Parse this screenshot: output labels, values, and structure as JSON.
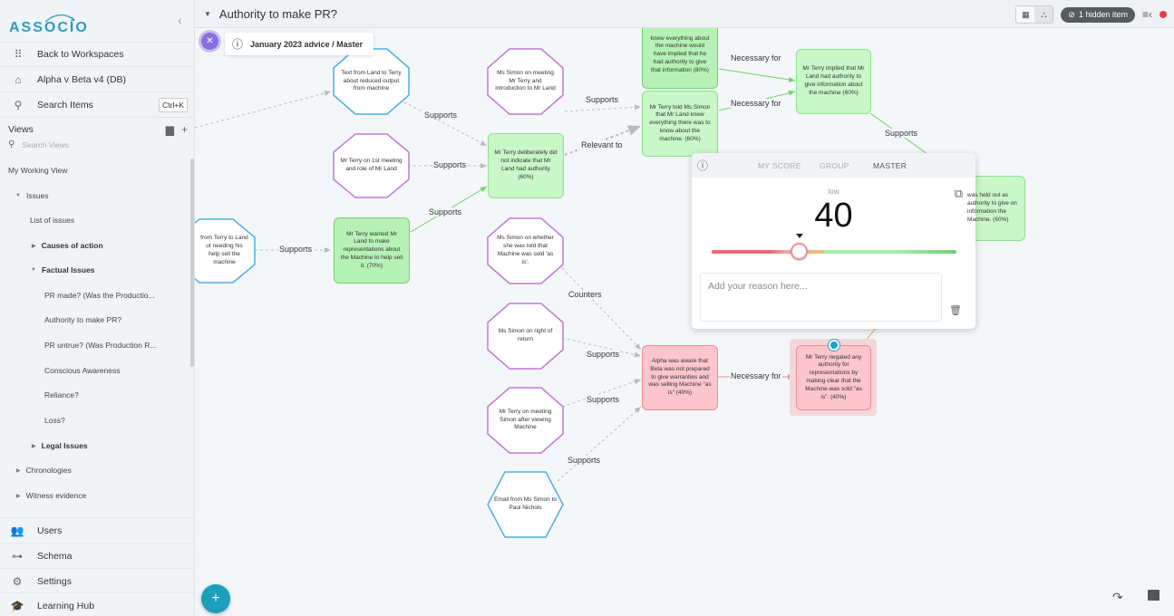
{
  "sidebar": {
    "logo": "ASSOCIO",
    "collapse_icon": "chevron-left-icon",
    "nav": [
      {
        "label": "Back to Workspaces",
        "icon": "grid-icon"
      },
      {
        "label": "Alpha v Beta v4 (DB)",
        "icon": "home-icon"
      },
      {
        "label": "Search Items",
        "icon": "search-icon",
        "shortcut": "Ctrl+K"
      }
    ],
    "views_label": "Views",
    "search_views_placeholder": "Search Views",
    "tree": [
      {
        "label": "My Working View",
        "level": 0
      },
      {
        "label": "Issues",
        "level": 0,
        "expanded": true
      },
      {
        "label": "List of issues",
        "level": 1
      },
      {
        "label": "Causes of action",
        "level": 1,
        "expanded": false
      },
      {
        "label": "Factual Issues",
        "level": 1,
        "expanded": true
      },
      {
        "label": "PR made? (Was the Productio...",
        "level": 2
      },
      {
        "label": "Authority to make PR?",
        "level": 2
      },
      {
        "label": "PR untrue? (Was Production R...",
        "level": 2
      },
      {
        "label": "Conscious Awareness",
        "level": 2
      },
      {
        "label": "Reliance?",
        "level": 2
      },
      {
        "label": "Loss?",
        "level": 2
      },
      {
        "label": "Legal Issues",
        "level": 1,
        "expanded": false
      },
      {
        "label": "Chronologies",
        "level": 0,
        "expanded": false
      },
      {
        "label": "Witness evidence",
        "level": 0,
        "expanded": false
      }
    ],
    "bottom": [
      {
        "label": "Users",
        "icon": "users-icon"
      },
      {
        "label": "Schema",
        "icon": "schema-icon"
      },
      {
        "label": "Settings",
        "icon": "gear-icon"
      },
      {
        "label": "Learning Hub",
        "icon": "graduation-cap-icon"
      }
    ]
  },
  "header": {
    "title": "Authority to make PR?",
    "hidden_items": "1 hidden item"
  },
  "canvas": {
    "version_chip": "January 2023 advice / Master",
    "nodes": {
      "n_text_land_terry": "Text from Land to Terry about reduced output from machine",
      "n_simon_meeting": "Ms Simon on meeting Mr Terry and introduction to Mr Land",
      "n_top_green": "knew everything about the machine would have implied that he had authority to give that information (80%)",
      "n_terry_implied": "Mr Terry implied that Mr Land had authority to give information about the machine (60%)",
      "n_terry_told": "Mr Terry told Ms Simon that Mr Land knew everything there was to know about the machine. (60%)",
      "n_terry_1st": "Mr Terry on 1st meeting and role of Mr Land",
      "n_deliberately": "Mr Terry deliberately did not indicate that Mr Land had authority (60%)",
      "n_text_terry_land": "from Terry to Land ut needing his help sell the machine",
      "n_terry_wanted": "Mr Terry wanted Mr Land to make representations about the Machine to help sell it. (70%)",
      "n_simon_asis": "Ms Simon on whether she was told that Machine was sold 'as is'.",
      "n_simon_return": "Ms Simon on right of return",
      "n_terry_viewing": "Mr Terry on meeting Simon after viewing Machine",
      "n_email": "Email from Ms Simon to Paul Nichols",
      "n_alpha_aware": "Alpha was aware that Beta was not prepared to give warranties and was selling Machine \"as is\" (40%)",
      "n_negated": "Mr Terry negated any authority for representations by making clear that the Machine was sold \"as is\". (40%)",
      "n_held_out": "was held out as authority to give on information the Machine. (60%)"
    },
    "edge_labels": {
      "supports": "Supports",
      "relevant_to": "Relevant to",
      "necessary_for": "Necessary for",
      "counters": "Counters"
    }
  },
  "score_popup": {
    "tabs": [
      "MY SCORE",
      "GROUP",
      "MASTER"
    ],
    "active_tab": "MASTER",
    "level_label": "low",
    "score": "40",
    "score_fraction": 0.36,
    "reason_placeholder": "Add your reason here..."
  },
  "colors": {
    "accent": "#1b9fba",
    "support_green": "#6fd26f",
    "counter_red": "#ef8a95",
    "witness_purple": "#c07ad8",
    "document_blue": "#4ab0e0"
  }
}
